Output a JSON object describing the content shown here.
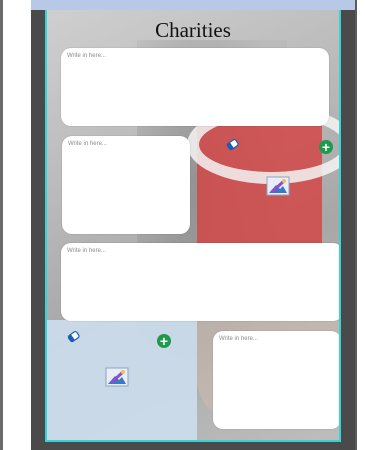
{
  "page": {
    "title": "Charities"
  },
  "text_boxes": [
    {
      "placeholder": "Write in here..."
    },
    {
      "placeholder": "Write in here..."
    },
    {
      "placeholder": "Write in here..."
    },
    {
      "placeholder": "Write in here..."
    }
  ],
  "icons": {
    "add": "plus-icon",
    "erase": "eraser-icon",
    "image": "image-icon"
  },
  "colors": {
    "page_border": "#33d6d6",
    "add_button": "#1e9a4e",
    "canvas_background": "#4a4a4a"
  }
}
